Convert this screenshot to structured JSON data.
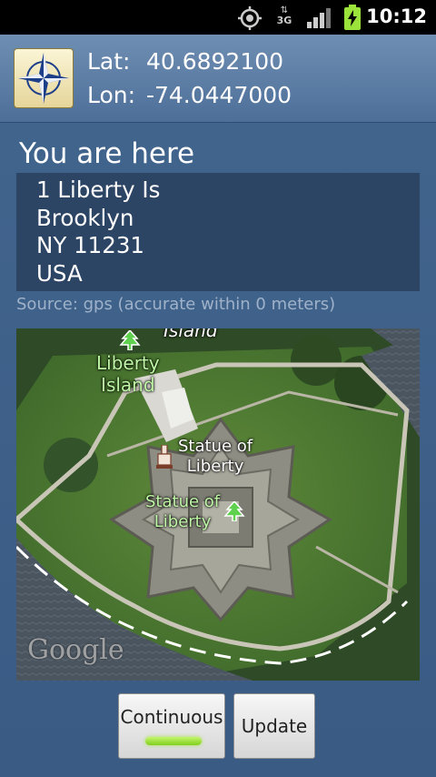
{
  "status_bar": {
    "time": "10:12",
    "icons": [
      "gps-icon",
      "3g-data-icon",
      "signal-icon",
      "battery-charging-icon"
    ],
    "network_label": "3G"
  },
  "header": {
    "lat_label": "Lat:",
    "lat_value": "40.6892100",
    "lon_label": "Lon:",
    "lon_value": "-74.0447000"
  },
  "location": {
    "title": "You are here",
    "address_lines": [
      "1 Liberty Is",
      "Brooklyn",
      "NY 11231",
      "USA"
    ],
    "source_text": "Source: gps (accurate within 0 meters)"
  },
  "map": {
    "labels": {
      "island_top": "Island",
      "liberty_island_1": "Liberty",
      "liberty_island_2": "Island",
      "statue_white_1": "Statue of",
      "statue_white_2": "Liberty",
      "statue_green_1": "Statue of",
      "statue_green_2": "Liberty"
    },
    "attribution": "Google",
    "pin_colors": {
      "park": "#5fd14f",
      "landmark": "#f3e4d8"
    }
  },
  "buttons": {
    "continuous": "Continuous",
    "update": "Update"
  },
  "colors": {
    "background": "#3e5f86",
    "address_box": "#2c4565",
    "indicator": "#9be23a"
  }
}
